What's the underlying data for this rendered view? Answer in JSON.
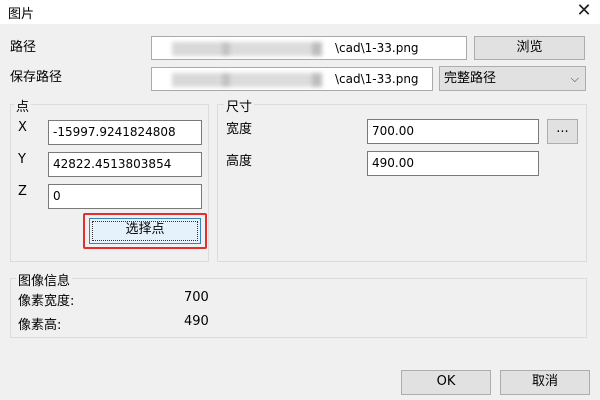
{
  "window": {
    "title": "图片",
    "close_glyph": "✕"
  },
  "path": {
    "label": "路径",
    "value": "\\cad\\1-33.png",
    "browse_button": "浏览"
  },
  "save_path": {
    "label": "保存路径",
    "value": "\\cad\\1-33.png",
    "mode_selected": "完整路径"
  },
  "point": {
    "group_title": "点",
    "x_label": "X",
    "x_value": "-15997.9241824808",
    "y_label": "Y",
    "y_value": "42822.4513803854",
    "z_label": "Z",
    "z_value": "0",
    "select_button": "选择点",
    "highlight_color": "#e03030"
  },
  "size": {
    "group_title": "尺寸",
    "width_label": "宽度",
    "width_value": "700.00",
    "ellipsis_button": "...",
    "height_label": "高度",
    "height_value": "490.00"
  },
  "image_info": {
    "group_title": "图像信息",
    "pixel_width_label": "像素宽度:",
    "pixel_width_value": "700",
    "pixel_height_label": "像素高:",
    "pixel_height_value": "490"
  },
  "footer": {
    "ok_label": "OK",
    "cancel_label": "取消"
  }
}
